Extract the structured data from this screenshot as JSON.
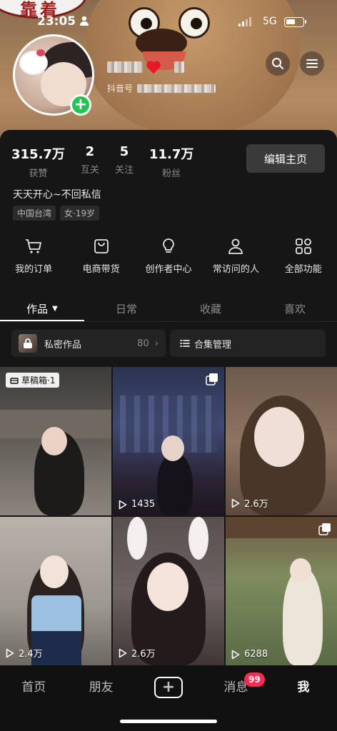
{
  "status_bar": {
    "time": "23:05",
    "network": "5G"
  },
  "header": {
    "logo_text": "靠着",
    "douyin_id_label": "抖音号",
    "search_icon": "search-icon",
    "menu_icon": "menu-icon"
  },
  "profile": {
    "stats": [
      {
        "value": "315.7万",
        "label": "获赞"
      },
      {
        "value": "2",
        "label": "互关"
      },
      {
        "value": "5",
        "label": "关注"
      },
      {
        "value": "11.7万",
        "label": "粉丝"
      }
    ],
    "edit_button": "编辑主页",
    "bio": "天天开心~不回私信",
    "tags": [
      "中国台湾",
      "女·19岁"
    ]
  },
  "shortcuts": [
    {
      "label": "我的订单",
      "icon": "cart-icon"
    },
    {
      "label": "电商带货",
      "icon": "shopping-bag-icon"
    },
    {
      "label": "创作者中心",
      "icon": "lightbulb-icon"
    },
    {
      "label": "常访问的人",
      "icon": "person-icon"
    },
    {
      "label": "全部功能",
      "icon": "grid-icon"
    }
  ],
  "tabs": [
    {
      "label": "作品",
      "active": true
    },
    {
      "label": "日常"
    },
    {
      "label": "收藏"
    },
    {
      "label": "喜欢"
    }
  ],
  "chips": {
    "private_label": "私密作品",
    "private_count": "80",
    "collection_label": "合集管理"
  },
  "grid": [
    {
      "draft_label": "草稿箱·1",
      "views": ""
    },
    {
      "views": "1435",
      "multi": true
    },
    {
      "views": "2.6万"
    },
    {
      "views": "2.4万"
    },
    {
      "views": "2.6万"
    },
    {
      "views": "6288",
      "multi": true
    }
  ],
  "bottom_nav": [
    {
      "label": "首页"
    },
    {
      "label": "朋友"
    },
    {
      "label": "+"
    },
    {
      "label": "消息"
    },
    {
      "label": "我",
      "active": true
    }
  ],
  "message_badge": "99",
  "colors": {
    "accent_green": "#23c552",
    "badge_red": "#fe2c55",
    "background": "#161616"
  }
}
